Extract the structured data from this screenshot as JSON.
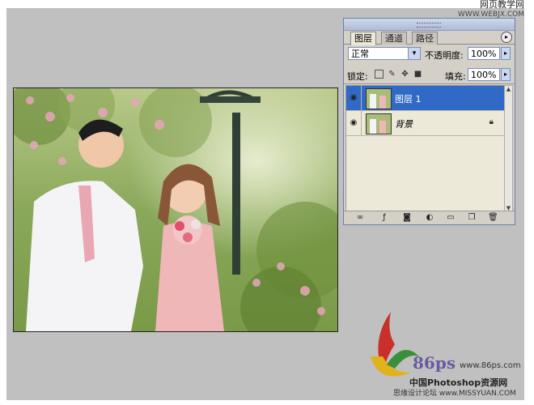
{
  "watermark": {
    "site_cn": "网页教学网",
    "site_url": "WWW.WEBJX.COM"
  },
  "layers_panel": {
    "tabs": [
      {
        "label": "图层",
        "active": true
      },
      {
        "label": "通道",
        "active": false
      },
      {
        "label": "路径",
        "active": false
      }
    ],
    "blend_mode": "正常",
    "opacity_label": "不透明度:",
    "opacity_value": "100%",
    "lock_label": "锁定:",
    "fill_label": "填充:",
    "fill_value": "100%",
    "layers": [
      {
        "name": "图层 1",
        "selected": true,
        "locked": false
      },
      {
        "name": "背景",
        "selected": false,
        "locked": true
      }
    ],
    "colors": {
      "selected_row": "#3169c6",
      "panel_bg": "#d4d0c8",
      "list_bg": "#ece9d8"
    }
  },
  "logo": {
    "brand": "86ps",
    "url": "www.86ps.com",
    "title_cn": "中国Photoshop资源网",
    "subtitle": "思缘设计论坛 www.MISSYUAN.COM"
  }
}
